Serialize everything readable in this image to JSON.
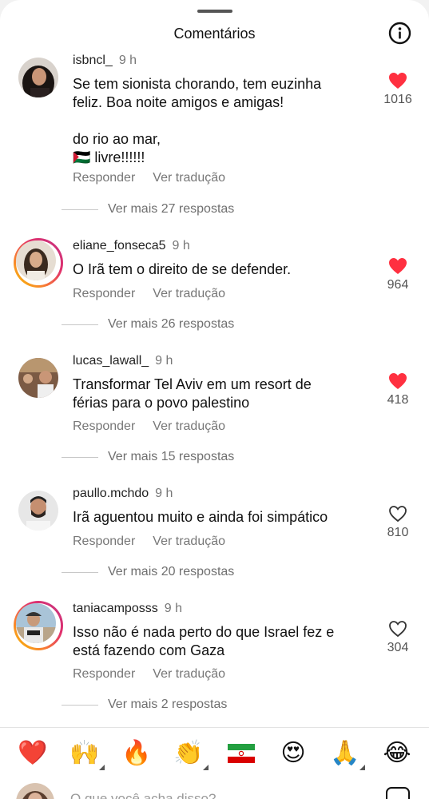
{
  "header": {
    "title": "Comentários",
    "info_icon": "info-circle-icon"
  },
  "comments": [
    {
      "username": "isbncl_",
      "time": "9 h",
      "text": "Se tem sionista chorando, tem euzinha\nfeliz. Boa noite amigos e amigas!\n\ndo rio ao mar,\n🇵🇸 livre!!!!!!",
      "reply_label": "Responder",
      "translate_label": "Ver tradução",
      "view_replies": "Ver mais 27 respostas",
      "likes": "1016",
      "liked": true,
      "story_ring": false
    },
    {
      "username": "eliane_fonseca5",
      "time": "9 h",
      "text": "O Irã tem o direito de se defender.",
      "reply_label": "Responder",
      "translate_label": "Ver tradução",
      "view_replies": "Ver mais 26 respostas",
      "likes": "964",
      "liked": true,
      "story_ring": true
    },
    {
      "username": "lucas_lawall_",
      "time": "9 h",
      "text": "Transformar Tel Aviv em um resort de\nférias para o povo palestino",
      "reply_label": "Responder",
      "translate_label": "Ver tradução",
      "view_replies": "Ver mais 15 respostas",
      "likes": "418",
      "liked": true,
      "story_ring": false
    },
    {
      "username": "paullo.mchdo",
      "time": "9 h",
      "text": "Irã aguentou muito e ainda foi simpático",
      "reply_label": "Responder",
      "translate_label": "Ver tradução",
      "view_replies": "Ver mais 20 respostas",
      "likes": "810",
      "liked": false,
      "story_ring": false
    },
    {
      "username": "taniacamposss",
      "time": "9 h",
      "text": "Isso não é nada perto do que Israel fez  e\nestá fazendo  com Gaza",
      "reply_label": "Responder",
      "translate_label": "Ver tradução",
      "view_replies": "Ver mais 2 respostas",
      "likes": "304",
      "liked": false,
      "story_ring": true
    }
  ],
  "emoji_bar": [
    "❤️",
    "🙌",
    "🔥",
    "👏",
    "🇮🇷",
    "😍",
    "🙏",
    "😂"
  ],
  "composer": {
    "placeholder": "O que você acha disso?",
    "gif_icon": "sticker-icon"
  },
  "colors": {
    "like_red": "#ff3040",
    "muted_text": "#777777"
  }
}
